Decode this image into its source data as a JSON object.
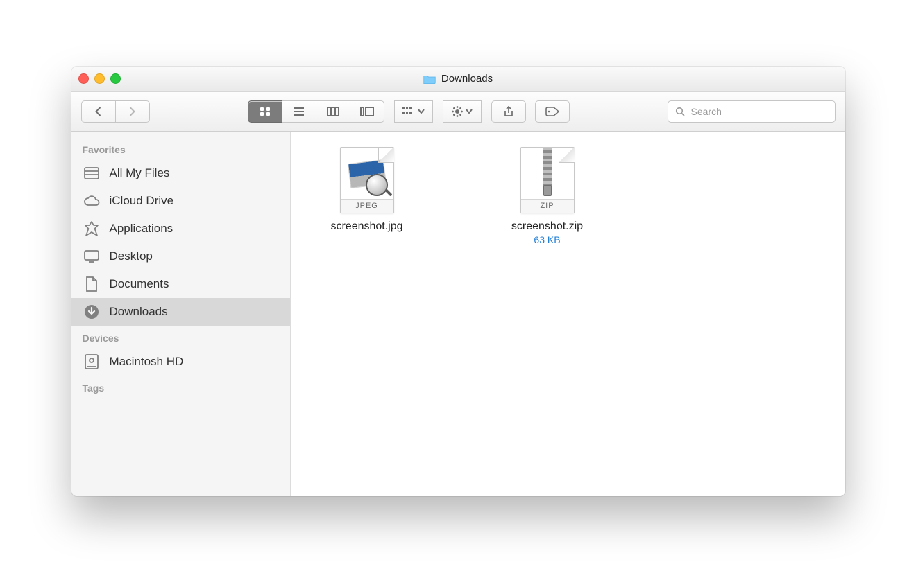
{
  "window": {
    "title": "Downloads"
  },
  "toolbar": {
    "search_placeholder": "Search"
  },
  "sidebar": {
    "sections": [
      {
        "header": "Favorites",
        "items": [
          {
            "label": "All My Files",
            "icon": "all-my-files"
          },
          {
            "label": "iCloud Drive",
            "icon": "cloud"
          },
          {
            "label": "Applications",
            "icon": "applications"
          },
          {
            "label": "Desktop",
            "icon": "desktop"
          },
          {
            "label": "Documents",
            "icon": "documents"
          },
          {
            "label": "Downloads",
            "icon": "downloads",
            "selected": true
          }
        ]
      },
      {
        "header": "Devices",
        "items": [
          {
            "label": "Macintosh HD",
            "icon": "disk"
          }
        ]
      },
      {
        "header": "Tags",
        "items": []
      }
    ]
  },
  "files": [
    {
      "name": "screenshot.jpg",
      "type_label": "JPEG",
      "kind": "image",
      "subtitle": ""
    },
    {
      "name": "screenshot.zip",
      "type_label": "ZIP",
      "kind": "archive",
      "subtitle": "63 KB"
    }
  ]
}
